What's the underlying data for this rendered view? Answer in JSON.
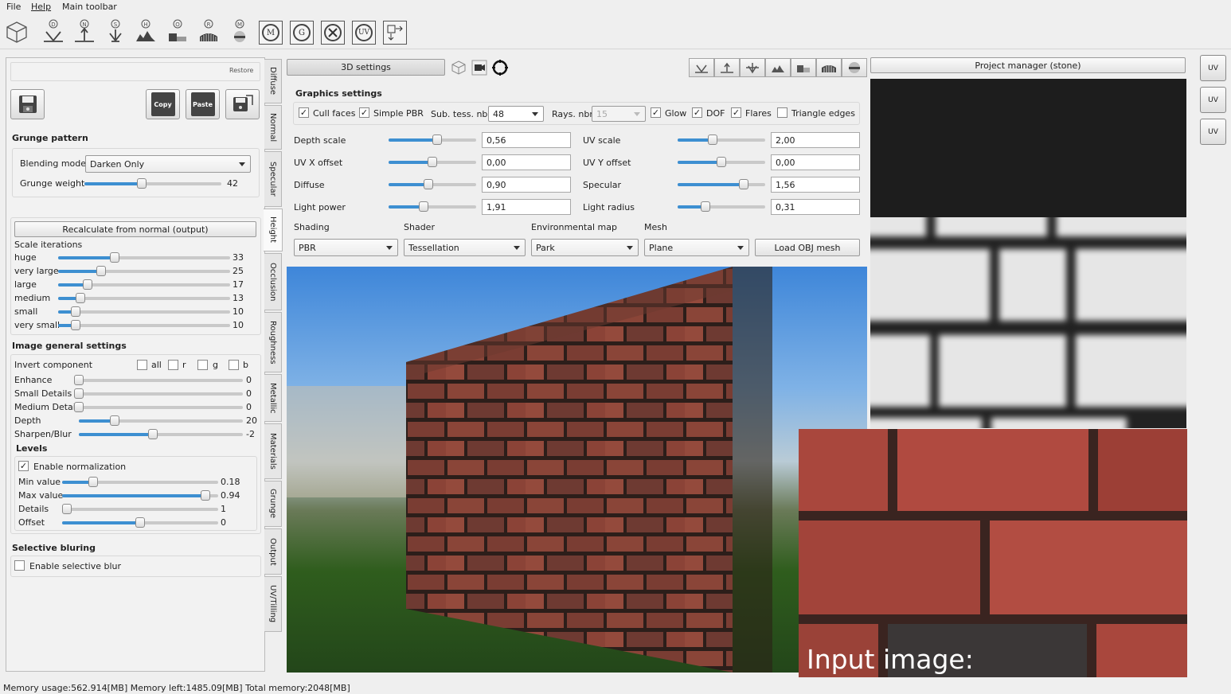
{
  "menu": [
    "File",
    "Help",
    "Main toolbar"
  ],
  "toolbar": {
    "items": [
      {
        "icon": "cube-icon"
      },
      {
        "icon": "diffuse-icon",
        "letter": "D"
      },
      {
        "icon": "normal-icon",
        "letter": "N"
      },
      {
        "icon": "specular-icon",
        "letter": "S"
      },
      {
        "icon": "height-icon",
        "letter": "H"
      },
      {
        "icon": "occlusion-icon",
        "letter": "O"
      },
      {
        "icon": "roughness-icon",
        "letter": "R"
      },
      {
        "icon": "metallic-icon",
        "letter": "M"
      },
      {
        "icon": "materials-icon",
        "letter": "M"
      },
      {
        "icon": "grunge-icon",
        "letter": "G"
      },
      {
        "icon": "settings-tools-icon"
      },
      {
        "icon": "uv-icon",
        "letter": "UV"
      },
      {
        "icon": "output-arrow-icon"
      }
    ]
  },
  "left": {
    "restore": "Restore",
    "copy": "Copy",
    "paste": "Paste",
    "grunge_title": "Grunge pattern",
    "blending_label": "Blending mode",
    "blending_value": "Darken Only",
    "grunge_weight_label": "Grunge weight",
    "grunge_weight": "42",
    "grunge_weight_level": 0.42,
    "recalc": "Recalculate from normal (output)",
    "scale_iter": "Scale iterations",
    "scales": [
      {
        "label": "huge",
        "value": "33",
        "level": 0.33
      },
      {
        "label": "very large",
        "value": "25",
        "level": 0.25
      },
      {
        "label": "large",
        "value": "17",
        "level": 0.17
      },
      {
        "label": "medium",
        "value": "13",
        "level": 0.13
      },
      {
        "label": "small",
        "value": "10",
        "level": 0.1
      },
      {
        "label": "very small",
        "value": "10",
        "level": 0.1
      }
    ],
    "image_general": "Image general settings",
    "invert_label": "Invert component",
    "invert_opts": [
      "all",
      "r",
      "g",
      "b"
    ],
    "general": [
      {
        "label": "Enhance",
        "value": "0",
        "level": 0.0
      },
      {
        "label": "Small Details",
        "value": "0",
        "level": 0.0
      },
      {
        "label": "Medium Details",
        "value": "0",
        "level": 0.0
      },
      {
        "label": "Depth",
        "value": "20",
        "level": 0.22
      },
      {
        "label": "Sharpen/Blur",
        "value": "-2",
        "level": 0.45
      }
    ],
    "levels_title": "Levels",
    "enable_norm": "Enable normalization",
    "levels": [
      {
        "label": "Min value",
        "value": "0.18",
        "level": 0.2
      },
      {
        "label": "Max value",
        "value": "0.94",
        "level": 0.92
      },
      {
        "label": "Details",
        "value": "1",
        "level": 0.03
      },
      {
        "label": "Offset",
        "value": "0",
        "level": 0.5
      }
    ],
    "selective_title": "Selective bluring",
    "selective_enable": "Enable selective blur"
  },
  "tabs": [
    "Diffuse",
    "Normal",
    "Specular",
    "Height",
    "Occlusion",
    "Roughness",
    "Metallic",
    "Materials",
    "Grunge",
    "Output",
    "UV/Tilling"
  ],
  "center": {
    "settings3d": "3D settings",
    "graphics_title": "Graphics settings",
    "cull_faces": "Cull faces",
    "simple_pbr": "Simple PBR",
    "sub_tess_label": "Sub. tess. nbr",
    "sub_tess_value": "48",
    "rays_label": "Rays. nbr",
    "rays_value": "15",
    "glow": "Glow",
    "dof": "DOF",
    "flares": "Flares",
    "triangle_edges": "Triangle edges",
    "params_left": [
      {
        "label": "Depth scale",
        "value": "0,56",
        "level": 0.55
      },
      {
        "label": "UV X offset",
        "value": "0,00",
        "level": 0.5
      },
      {
        "label": "Diffuse",
        "value": "0,90",
        "level": 0.45
      },
      {
        "label": "Light power",
        "value": "1,91",
        "level": 0.4
      }
    ],
    "params_right": [
      {
        "label": "UV scale",
        "value": "2,00",
        "level": 0.4
      },
      {
        "label": "UV Y offset",
        "value": "0,00",
        "level": 0.5
      },
      {
        "label": "Specular",
        "value": "1,56",
        "level": 0.75
      },
      {
        "label": "Light radius",
        "value": "0,31",
        "level": 0.32
      }
    ],
    "shading_label": "Shading",
    "shading_value": "PBR",
    "shader_label": "Shader",
    "shader_value": "Tessellation",
    "envmap_label": "Environmental map",
    "envmap_value": "Park",
    "mesh_label": "Mesh",
    "mesh_value": "Plane",
    "load_obj": "Load OBJ mesh"
  },
  "right": {
    "project_manager": "Project manager (stone)",
    "input_image": "Input image:"
  },
  "side_buttons": [
    "UV",
    "UV",
    "UV"
  ],
  "status": "Memory usage:562.914[MB] Memory left:1485.09[MB] Total memory:2048[MB]"
}
